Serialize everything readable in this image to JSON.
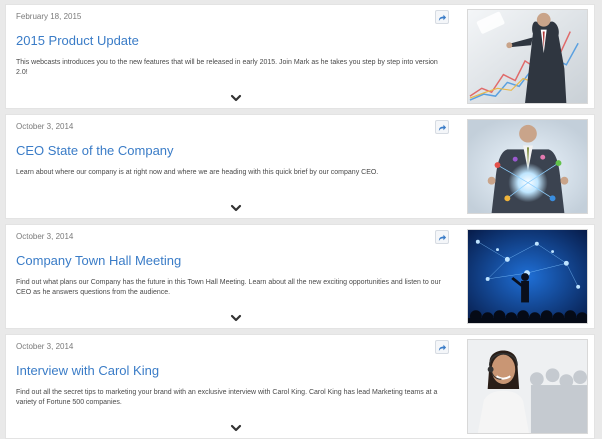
{
  "webcasts": [
    {
      "date": "February 18, 2015",
      "title": "2015 Product Update",
      "description": "This webcasts introduces you to the new features that will be released in early 2015. Join Mark as he takes you step by step into version 2.0!",
      "thumbnail": "businessman-touching-growth-chart-image"
    },
    {
      "date": "October 3, 2014",
      "title": "CEO State of the Company",
      "description": "Learn about where our company is at right now and where we are heading with this quick brief by our company CEO.",
      "thumbnail": "businessman-holding-glowing-network-image"
    },
    {
      "date": "October 3, 2014",
      "title": "Company Town Hall Meeting",
      "description": "Find out what plans our Company has the future in this Town Hall Meeting. Learn about all the new exciting opportunities and listen to our CEO as he answers questions from the audience.",
      "thumbnail": "speaker-on-stage-network-image"
    },
    {
      "date": "October 3, 2014",
      "title": "Interview with Carol King",
      "description": "Find out all the secret tips to marketing your brand with an exclusive interview with Carol King. Carol King has lead Marketing teams at a variety of Fortune 500 companies.",
      "thumbnail": "smiling-woman-with-headset-image"
    }
  ],
  "icons": {
    "share": "share-icon",
    "expand": "chevron-down-icon"
  },
  "colors": {
    "title": "#3a7cc7",
    "background": "#e9e9e9",
    "card": "#ffffff"
  }
}
